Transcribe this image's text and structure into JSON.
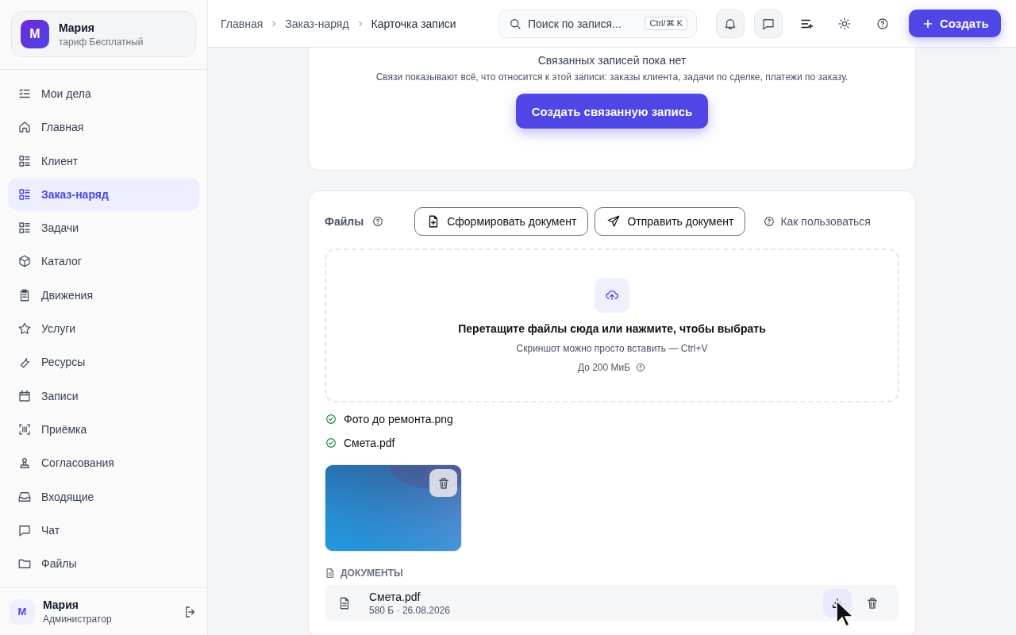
{
  "sidebar": {
    "account": {
      "avatar": "М",
      "name": "Мария",
      "plan": "тариф Бесплатный"
    },
    "items": [
      {
        "label": "Мои дела",
        "selected": false
      },
      {
        "label": "Главная",
        "selected": false
      },
      {
        "label": "Клиент",
        "selected": false
      },
      {
        "label": "Заказ-наряд",
        "selected": true
      },
      {
        "label": "Задачи",
        "selected": false
      },
      {
        "label": "Каталог",
        "selected": false
      },
      {
        "label": "Движения",
        "selected": false
      },
      {
        "label": "Услуги",
        "selected": false
      },
      {
        "label": "Ресурсы",
        "selected": false
      },
      {
        "label": "Записи",
        "selected": false
      },
      {
        "label": "Приёмка",
        "selected": false
      },
      {
        "label": "Согласования",
        "selected": false
      },
      {
        "label": "Входящие",
        "selected": false
      },
      {
        "label": "Чат",
        "selected": false
      },
      {
        "label": "Файлы",
        "selected": false
      }
    ],
    "user": {
      "avatar": "М",
      "name": "Мария",
      "role": "Администратор"
    }
  },
  "breadcrumbs": [
    "Главная",
    "Заказ-наряд",
    "Карточка записи"
  ],
  "search": {
    "placeholder": "Поиск по запися...",
    "shortcut": "Ctrl/⌘ K"
  },
  "create_button": "Создать",
  "related": {
    "title": "Связанных записей пока нет",
    "description": "Связи показывают всё, что относится к этой записи: заказы клиента, задачи по сделке, платежи по заказу.",
    "button": "Создать связанную запись"
  },
  "files": {
    "title": "Файлы",
    "buttons": [
      "Сформировать документ",
      "Отправить документ"
    ],
    "help_link": "Как пользоваться",
    "dropzone": {
      "title": "Перетащите файлы сюда или нажмите, чтобы выбрать",
      "hint": "Скриншот можно просто вставить — Ctrl+V",
      "limit": "До 200 МиБ"
    },
    "uploaded": [
      {
        "name": "Фото до ремонта.png",
        "done": true
      },
      {
        "name": "Смета.pdf",
        "done": true
      }
    ],
    "thumbnails": [
      {
        "kind": "picture"
      }
    ],
    "documents": {
      "title": "ДОКУМЕНТЫ",
      "items": [
        {
          "name": "Смета.pdf",
          "meta": "580 Б · 26.08.2026"
        }
      ]
    }
  }
}
